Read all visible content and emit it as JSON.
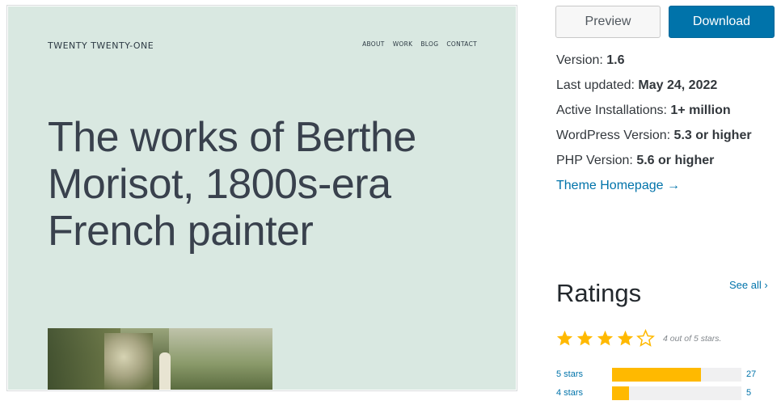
{
  "screenshot": {
    "site_title": "TWENTY TWENTY-ONE",
    "nav": [
      "ABOUT",
      "WORK",
      "BLOG",
      "CONTACT"
    ],
    "hero_lines": [
      "The works of Berthe",
      "Morisot, 1800s-era",
      "French painter"
    ]
  },
  "actions": {
    "preview_label": "Preview",
    "download_label": "Download"
  },
  "meta": [
    {
      "label": "Version: ",
      "value": "1.6"
    },
    {
      "label": "Last updated: ",
      "value": "May 24, 2022"
    },
    {
      "label": "Active Installations: ",
      "value": "1+ million"
    },
    {
      "label": "WordPress Version: ",
      "value": "5.3 or higher"
    },
    {
      "label": "PHP Version: ",
      "value": "5.6 or higher"
    }
  ],
  "theme_homepage_link": "Theme Homepage →",
  "ratings": {
    "heading": "Ratings",
    "see_all": "See all ›",
    "stars": 4,
    "stars_max": 5,
    "rating_text": "4 out of 5 stars.",
    "bars": [
      {
        "label": "5 stars",
        "count": "27",
        "fill_fraction": 0.69
      },
      {
        "label": "4 stars",
        "count": "5",
        "fill_fraction": 0.13
      }
    ]
  },
  "colors": {
    "accent": "#0073aa",
    "star": "#ffb900",
    "preview_bg": "#d9e8e1"
  },
  "icons": {
    "star": "star-icon",
    "arrow": "arrow-right-icon",
    "chevron": "chevron-right-icon"
  }
}
